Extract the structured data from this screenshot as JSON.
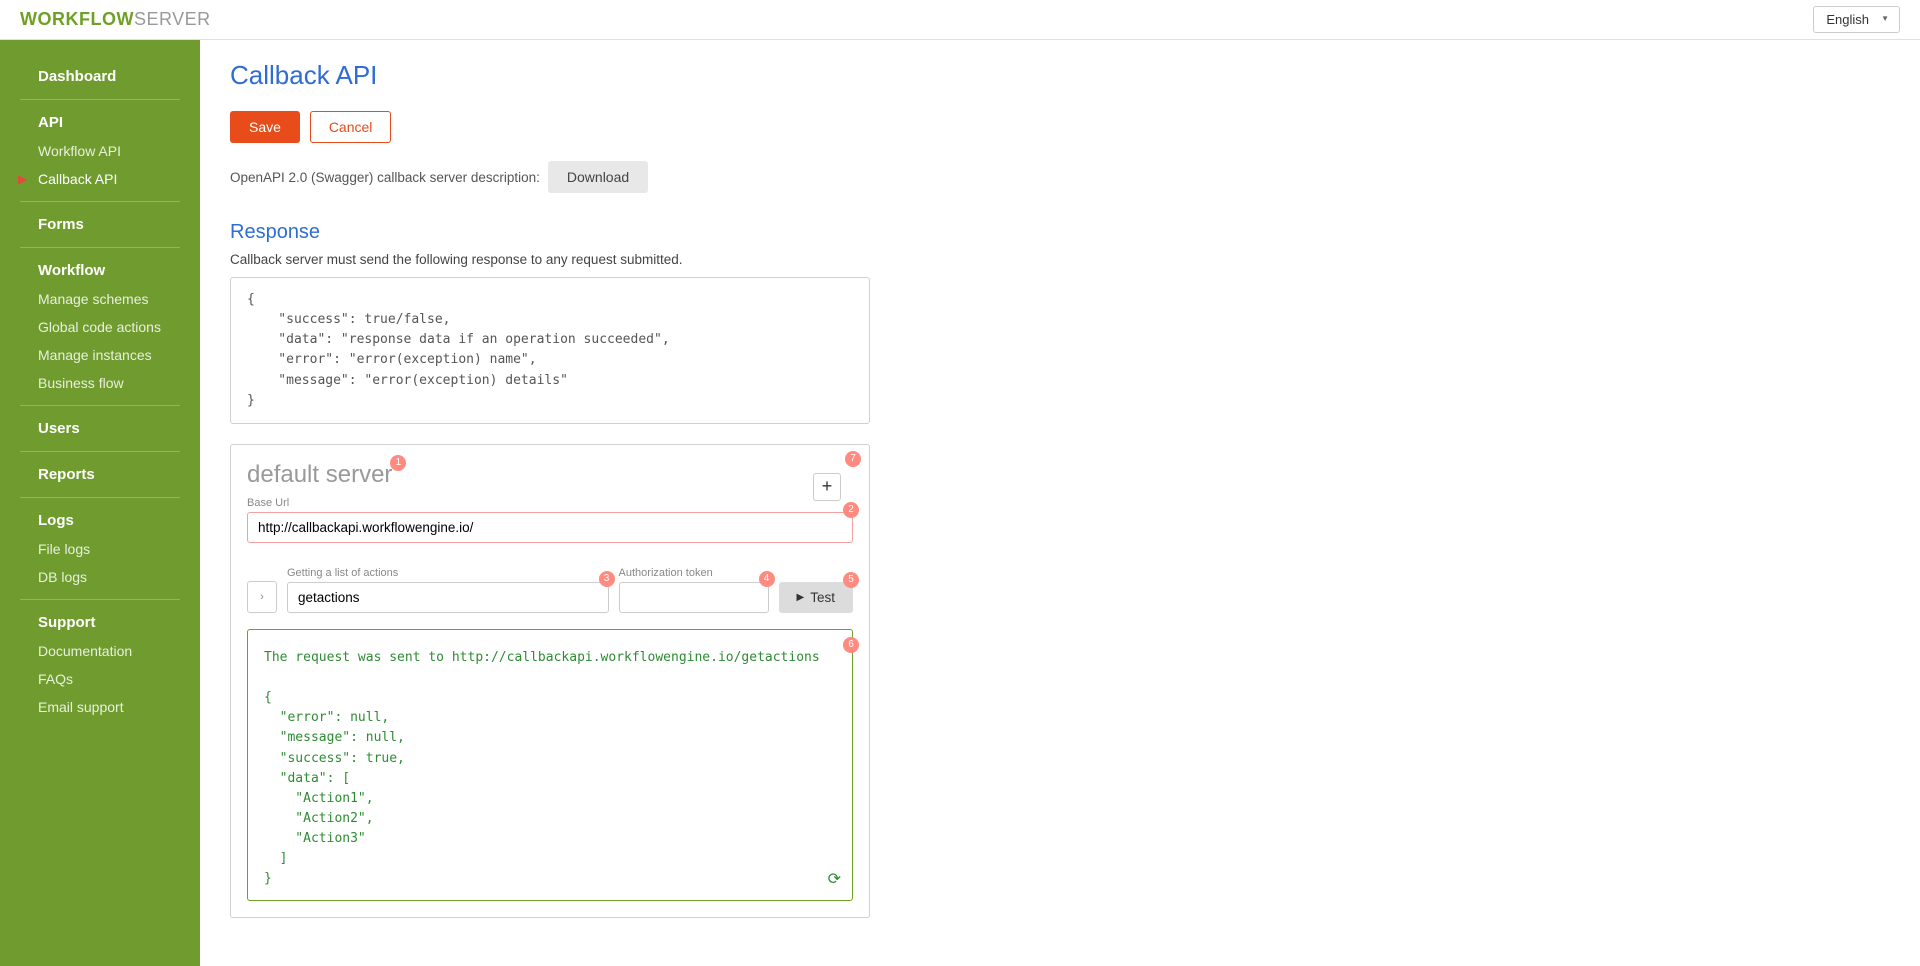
{
  "header": {
    "logo_bold": "WORKFLOW",
    "logo_light": "SERVER",
    "language": "English"
  },
  "sidebar": {
    "sections": [
      {
        "head": "Dashboard",
        "items": []
      },
      {
        "head": "API",
        "items": [
          "Workflow API",
          "Callback API"
        ],
        "active_index": 1
      },
      {
        "head": "Forms",
        "items": []
      },
      {
        "head": "Workflow",
        "items": [
          "Manage schemes",
          "Global code actions",
          "Manage instances",
          "Business flow"
        ]
      },
      {
        "head": "Users",
        "items": []
      },
      {
        "head": "Reports",
        "items": []
      },
      {
        "head": "Logs",
        "items": [
          "File logs",
          "DB logs"
        ]
      },
      {
        "head": "Support",
        "items": [
          "Documentation",
          "FAQs",
          "Email support"
        ]
      }
    ]
  },
  "page": {
    "title": "Callback API",
    "save": "Save",
    "cancel": "Cancel",
    "swagger_text": "OpenAPI 2.0 (Swagger) callback server description:",
    "download": "Download",
    "response_title": "Response",
    "response_desc": "Callback server must send the following response to any request submitted.",
    "response_example": "{\n    \"success\": true/false,\n    \"data\": \"response data if an operation succeeded\",\n    \"error\": \"error(exception) name\",\n    \"message\": \"error(exception) details\"\n}",
    "server": {
      "name": "default server",
      "base_url_label": "Base Url",
      "base_url": "http://callbackapi.workflowengine.io/",
      "action_label": "Getting a list of actions",
      "action_value": "getactions",
      "token_label": "Authorization token",
      "token_value": "",
      "test_label": "Test",
      "output": "The request was sent to http://callbackapi.workflowengine.io/getactions\n\n{\n  \"error\": null,\n  \"message\": null,\n  \"success\": true,\n  \"data\": [\n    \"Action1\",\n    \"Action2\",\n    \"Action3\"\n  ]\n}"
    },
    "badges": [
      "1",
      "2",
      "3",
      "4",
      "5",
      "6",
      "7"
    ]
  }
}
